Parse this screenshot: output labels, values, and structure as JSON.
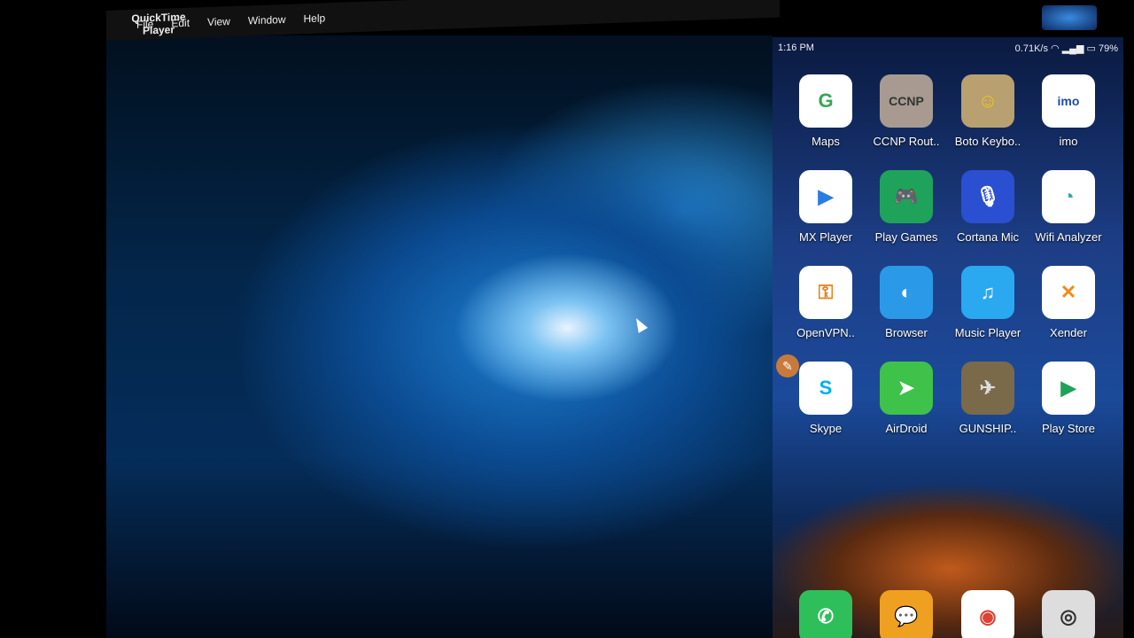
{
  "menubar": {
    "apple": "",
    "app": "QuickTime Player",
    "items": [
      "File",
      "Edit",
      "View",
      "Window",
      "Help"
    ]
  },
  "status": {
    "time": "1:16 PM",
    "speed": "0.71K/s",
    "battery": "79%"
  },
  "apps": [
    {
      "label": "Maps",
      "glyph": "G",
      "color": "#ffffff",
      "fg": "#34a853",
      "icon": "maps-icon"
    },
    {
      "label": "CCNP Rout..",
      "glyph": "CCNP",
      "color": "#a89a90",
      "fg": "#333",
      "icon": "ccnp-icon"
    },
    {
      "label": "Boto Keybo..",
      "glyph": "☺",
      "color": "#b8a070",
      "fg": "#f5c518",
      "icon": "boto-keyboard-icon"
    },
    {
      "label": "imo",
      "glyph": "imo",
      "color": "#ffffff",
      "fg": "#1f4aa8",
      "icon": "imo-icon"
    },
    {
      "label": "MX Player",
      "glyph": "▶",
      "color": "#ffffff",
      "fg": "#2a7de1",
      "icon": "mx-player-icon"
    },
    {
      "label": "Play Games",
      "glyph": "🎮",
      "color": "#1fa35a",
      "fg": "#fff",
      "icon": "play-games-icon"
    },
    {
      "label": "Cortana Mic",
      "glyph": "🎙",
      "color": "#2a4fd0",
      "fg": "#fff",
      "icon": "cortana-mic-icon"
    },
    {
      "label": "Wifi Analyzer",
      "glyph": "◔",
      "color": "#ffffff",
      "fg": "#2aa3c0",
      "icon": "wifi-analyzer-icon"
    },
    {
      "label": "OpenVPN..",
      "glyph": "⚿",
      "color": "#ffffff",
      "fg": "#e8801a",
      "icon": "openvpn-icon"
    },
    {
      "label": "Browser",
      "glyph": "◐",
      "color": "#2a9ae8",
      "fg": "#fff",
      "icon": "browser-icon"
    },
    {
      "label": "Music Player",
      "glyph": "♫",
      "color": "#2aa8f0",
      "fg": "#fff",
      "icon": "music-player-icon"
    },
    {
      "label": "Xender",
      "glyph": "✕",
      "color": "#ffffff",
      "fg": "#f28a1a",
      "icon": "xender-icon"
    },
    {
      "label": "Skype",
      "glyph": "S",
      "color": "#ffffff",
      "fg": "#00aff0",
      "icon": "skype-icon"
    },
    {
      "label": "AirDroid",
      "glyph": "➤",
      "color": "#3ec24a",
      "fg": "#fff",
      "icon": "airdroid-icon"
    },
    {
      "label": "GUNSHIP..",
      "glyph": "✈",
      "color": "#7a6a4a",
      "fg": "#ddd",
      "icon": "gunship-icon"
    },
    {
      "label": "Play Store",
      "glyph": "▶",
      "color": "#ffffff",
      "fg": "#1fa35a",
      "icon": "play-store-icon"
    }
  ],
  "dock": [
    {
      "glyph": "✆",
      "color": "#2fbf5a",
      "fg": "#fff",
      "icon": "phone-icon"
    },
    {
      "glyph": "💬",
      "color": "#f0a020",
      "fg": "#fff",
      "icon": "messages-icon"
    },
    {
      "glyph": "◉",
      "color": "#ffffff",
      "fg": "#db4437",
      "icon": "chrome-icon"
    },
    {
      "glyph": "◎",
      "color": "#dddddd",
      "fg": "#333",
      "icon": "camera-icon"
    }
  ]
}
